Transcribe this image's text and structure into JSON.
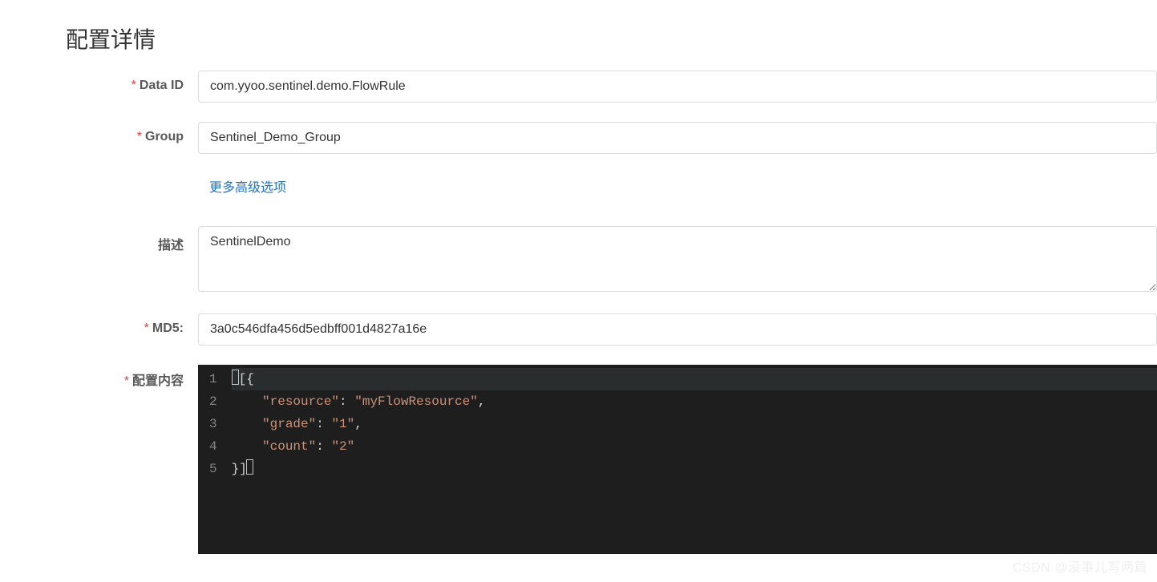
{
  "page": {
    "title": "配置详情"
  },
  "form": {
    "data_id": {
      "label": "Data ID",
      "required": true,
      "value": "com.yyoo.sentinel.demo.FlowRule"
    },
    "group": {
      "label": "Group",
      "required": true,
      "value": "Sentinel_Demo_Group"
    },
    "more_link": "更多高级选项",
    "description": {
      "label": "描述",
      "required": false,
      "value": "SentinelDemo"
    },
    "md5": {
      "label": "MD5:",
      "required": true,
      "value": "3a0c546dfa456d5edbff001d4827a16e"
    },
    "content": {
      "label": "配置内容",
      "required": true,
      "lines": [
        "[{",
        "    \"resource\": \"myFlowResource\",",
        "    \"grade\": \"1\",",
        "    \"count\": \"2\"",
        "}]"
      ],
      "line_numbers": [
        "1",
        "2",
        "3",
        "4",
        "5"
      ]
    }
  },
  "watermark": "CSDN @没事儿写两篇"
}
